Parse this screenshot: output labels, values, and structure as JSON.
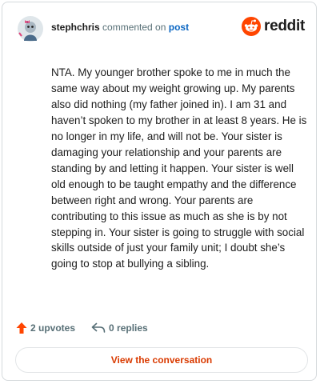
{
  "comment": {
    "username": "stephchris",
    "action_text": "commented on",
    "post_link": "post",
    "body": "NTA. My younger brother spoke to me in much the same way about my weight growing up. My parents also did nothing (my father joined in). I am 31 and haven’t spoken to my brother in at least 8 years. He is no longer in my life, and will not be. Your sister is damaging your relationship and your parents are standing by and letting it happen. Your sister is well old enough to be taught empathy and the difference between right and wrong. Your parents are contributing to this issue as much as she is by not stepping in. Your sister is going to struggle with social skills outside of just your family unit; I doubt she’s going to stop at bullying a sibling."
  },
  "brand": {
    "name": "reddit",
    "icon": "reddit-snoo-icon",
    "color": "#ff4500"
  },
  "stats": {
    "upvotes": "2 upvotes",
    "replies": "0 replies"
  },
  "cta": {
    "label": "View the conversation"
  },
  "colors": {
    "accent": "#d93a00",
    "upvote": "#ff4500",
    "link": "#0a66c2",
    "muted": "#576f76"
  }
}
